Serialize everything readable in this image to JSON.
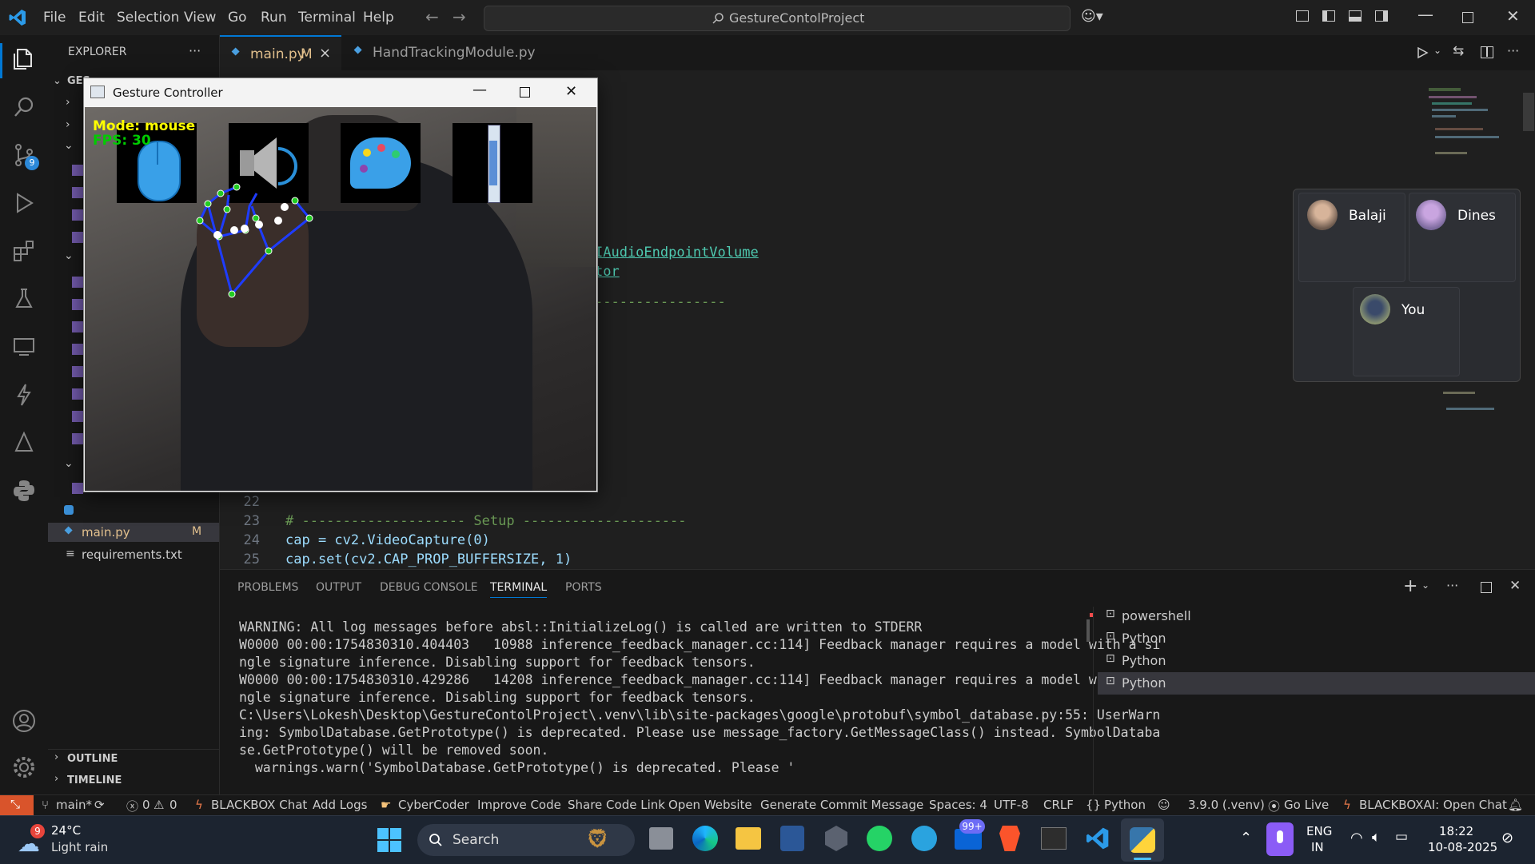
{
  "titlebar": {
    "menus": [
      "File",
      "Edit",
      "Selection",
      "View",
      "Go",
      "Run",
      "Terminal",
      "Help"
    ],
    "search_text": "GestureContolProject"
  },
  "activitybar": {
    "source_control_badge": "9"
  },
  "sidebar": {
    "title": "EXPLORER",
    "more": "···",
    "root_label": "GES",
    "files": [
      {
        "name": "main.py",
        "status": "M"
      },
      {
        "name": "requirements.txt",
        "status": ""
      }
    ],
    "outline": "OUTLINE",
    "timeline": "TIMELINE"
  },
  "tabs": [
    {
      "name": "main.py",
      "status": "M",
      "close": "×"
    },
    {
      "name": "HandTrackingModule.py"
    }
  ],
  "editor": {
    "visible_fragments": [
      {
        "text": "IAudioEndpointVolume"
      },
      {
        "text": "tor"
      },
      {
        "text": "----------------"
      }
    ],
    "lines": [
      {
        "num": "22",
        "text": ""
      },
      {
        "num": "23",
        "text": "# -------------------- Setup --------------------"
      },
      {
        "num": "24",
        "text": "cap = cv2.VideoCapture(0)"
      },
      {
        "num": "25",
        "text": "cap.set(cv2.CAP_PROP_BUFFERSIZE, 1)"
      }
    ]
  },
  "panel": {
    "tabs": [
      "PROBLEMS",
      "OUTPUT",
      "DEBUG CONSOLE",
      "TERMINAL",
      "PORTS"
    ],
    "active_tab": "TERMINAL",
    "terminal_lines": [
      "WARNING: All log messages before absl::InitializeLog() is called are written to STDERR",
      "W0000 00:00:1754830310.404403   10988 inference_feedback_manager.cc:114] Feedback manager requires a model with a si",
      "ngle signature inference. Disabling support for feedback tensors.",
      "W0000 00:00:1754830310.429286   14208 inference_feedback_manager.cc:114] Feedback manager requires a model with a si",
      "ngle signature inference. Disabling support for feedback tensors.",
      "C:\\Users\\Lokesh\\Desktop\\GestureContolProject\\.venv\\lib\\site-packages\\google\\protobuf\\symbol_database.py:55: UserWarn",
      "ing: SymbolDatabase.GetPrototype() is deprecated. Please use message_factory.GetMessageClass() instead. SymbolDataba",
      "se.GetPrototype() will be removed soon.",
      "  warnings.warn('SymbolDatabase.GetPrototype() is deprecated. Please '"
    ],
    "terminals": [
      "powershell",
      "Python",
      "Python",
      "Python"
    ]
  },
  "statusbar": {
    "branch": "main*",
    "errors": "0",
    "warnings": "0",
    "items": [
      "BLACKBOX Chat",
      "Add Logs",
      "CyberCoder",
      "Improve Code",
      "Share Code Link",
      "Open Website",
      "Generate Commit Message"
    ],
    "spaces": "Spaces: 4",
    "encoding": "UTF-8",
    "eol": "CRLF",
    "language": "Python",
    "interpreter": "3.9.0 (.venv)",
    "golive": "Go Live",
    "blackbox_open": "BLACKBOXAI: Open Chat"
  },
  "gesture_window": {
    "title": "Gesture Controller",
    "mode_text": "Mode: mouse",
    "fps_text": "FPS: 30"
  },
  "meeting": {
    "participants": [
      "Balaji",
      "Dines",
      "You"
    ]
  },
  "taskbar": {
    "weather_temp": "24°C",
    "weather_desc": "Light rain",
    "weather_badge": "9",
    "search": "Search",
    "mail_badge": "99+",
    "lang_top": "ENG",
    "lang_bottom": "IN",
    "time": "18:22",
    "date": "10-08-2025"
  },
  "colors": {
    "accent": "#0078d4",
    "badge": "#2b88d8",
    "hand_line": "#1e3cff",
    "landmark": "#22cc22",
    "mode_text": "#ffff00",
    "fps_text": "#00cc00"
  }
}
